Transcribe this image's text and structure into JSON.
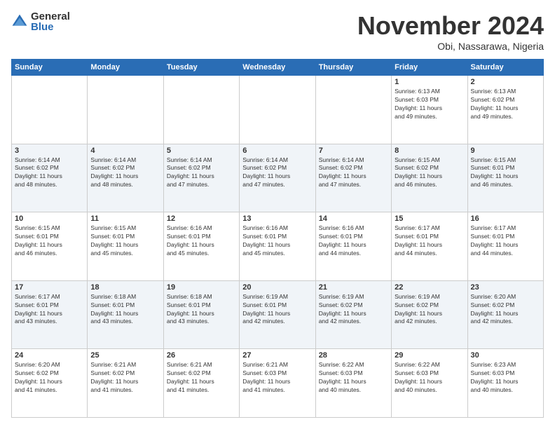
{
  "logo": {
    "general": "General",
    "blue": "Blue"
  },
  "header": {
    "month": "November 2024",
    "location": "Obi, Nassarawa, Nigeria"
  },
  "weekdays": [
    "Sunday",
    "Monday",
    "Tuesday",
    "Wednesday",
    "Thursday",
    "Friday",
    "Saturday"
  ],
  "weeks": [
    [
      {
        "day": "",
        "text": ""
      },
      {
        "day": "",
        "text": ""
      },
      {
        "day": "",
        "text": ""
      },
      {
        "day": "",
        "text": ""
      },
      {
        "day": "",
        "text": ""
      },
      {
        "day": "1",
        "text": "Sunrise: 6:13 AM\nSunset: 6:03 PM\nDaylight: 11 hours\nand 49 minutes."
      },
      {
        "day": "2",
        "text": "Sunrise: 6:13 AM\nSunset: 6:02 PM\nDaylight: 11 hours\nand 49 minutes."
      }
    ],
    [
      {
        "day": "3",
        "text": "Sunrise: 6:14 AM\nSunset: 6:02 PM\nDaylight: 11 hours\nand 48 minutes."
      },
      {
        "day": "4",
        "text": "Sunrise: 6:14 AM\nSunset: 6:02 PM\nDaylight: 11 hours\nand 48 minutes."
      },
      {
        "day": "5",
        "text": "Sunrise: 6:14 AM\nSunset: 6:02 PM\nDaylight: 11 hours\nand 47 minutes."
      },
      {
        "day": "6",
        "text": "Sunrise: 6:14 AM\nSunset: 6:02 PM\nDaylight: 11 hours\nand 47 minutes."
      },
      {
        "day": "7",
        "text": "Sunrise: 6:14 AM\nSunset: 6:02 PM\nDaylight: 11 hours\nand 47 minutes."
      },
      {
        "day": "8",
        "text": "Sunrise: 6:15 AM\nSunset: 6:02 PM\nDaylight: 11 hours\nand 46 minutes."
      },
      {
        "day": "9",
        "text": "Sunrise: 6:15 AM\nSunset: 6:01 PM\nDaylight: 11 hours\nand 46 minutes."
      }
    ],
    [
      {
        "day": "10",
        "text": "Sunrise: 6:15 AM\nSunset: 6:01 PM\nDaylight: 11 hours\nand 46 minutes."
      },
      {
        "day": "11",
        "text": "Sunrise: 6:15 AM\nSunset: 6:01 PM\nDaylight: 11 hours\nand 45 minutes."
      },
      {
        "day": "12",
        "text": "Sunrise: 6:16 AM\nSunset: 6:01 PM\nDaylight: 11 hours\nand 45 minutes."
      },
      {
        "day": "13",
        "text": "Sunrise: 6:16 AM\nSunset: 6:01 PM\nDaylight: 11 hours\nand 45 minutes."
      },
      {
        "day": "14",
        "text": "Sunrise: 6:16 AM\nSunset: 6:01 PM\nDaylight: 11 hours\nand 44 minutes."
      },
      {
        "day": "15",
        "text": "Sunrise: 6:17 AM\nSunset: 6:01 PM\nDaylight: 11 hours\nand 44 minutes."
      },
      {
        "day": "16",
        "text": "Sunrise: 6:17 AM\nSunset: 6:01 PM\nDaylight: 11 hours\nand 44 minutes."
      }
    ],
    [
      {
        "day": "17",
        "text": "Sunrise: 6:17 AM\nSunset: 6:01 PM\nDaylight: 11 hours\nand 43 minutes."
      },
      {
        "day": "18",
        "text": "Sunrise: 6:18 AM\nSunset: 6:01 PM\nDaylight: 11 hours\nand 43 minutes."
      },
      {
        "day": "19",
        "text": "Sunrise: 6:18 AM\nSunset: 6:01 PM\nDaylight: 11 hours\nand 43 minutes."
      },
      {
        "day": "20",
        "text": "Sunrise: 6:19 AM\nSunset: 6:01 PM\nDaylight: 11 hours\nand 42 minutes."
      },
      {
        "day": "21",
        "text": "Sunrise: 6:19 AM\nSunset: 6:02 PM\nDaylight: 11 hours\nand 42 minutes."
      },
      {
        "day": "22",
        "text": "Sunrise: 6:19 AM\nSunset: 6:02 PM\nDaylight: 11 hours\nand 42 minutes."
      },
      {
        "day": "23",
        "text": "Sunrise: 6:20 AM\nSunset: 6:02 PM\nDaylight: 11 hours\nand 42 minutes."
      }
    ],
    [
      {
        "day": "24",
        "text": "Sunrise: 6:20 AM\nSunset: 6:02 PM\nDaylight: 11 hours\nand 41 minutes."
      },
      {
        "day": "25",
        "text": "Sunrise: 6:21 AM\nSunset: 6:02 PM\nDaylight: 11 hours\nand 41 minutes."
      },
      {
        "day": "26",
        "text": "Sunrise: 6:21 AM\nSunset: 6:02 PM\nDaylight: 11 hours\nand 41 minutes."
      },
      {
        "day": "27",
        "text": "Sunrise: 6:21 AM\nSunset: 6:03 PM\nDaylight: 11 hours\nand 41 minutes."
      },
      {
        "day": "28",
        "text": "Sunrise: 6:22 AM\nSunset: 6:03 PM\nDaylight: 11 hours\nand 40 minutes."
      },
      {
        "day": "29",
        "text": "Sunrise: 6:22 AM\nSunset: 6:03 PM\nDaylight: 11 hours\nand 40 minutes."
      },
      {
        "day": "30",
        "text": "Sunrise: 6:23 AM\nSunset: 6:03 PM\nDaylight: 11 hours\nand 40 minutes."
      }
    ]
  ]
}
